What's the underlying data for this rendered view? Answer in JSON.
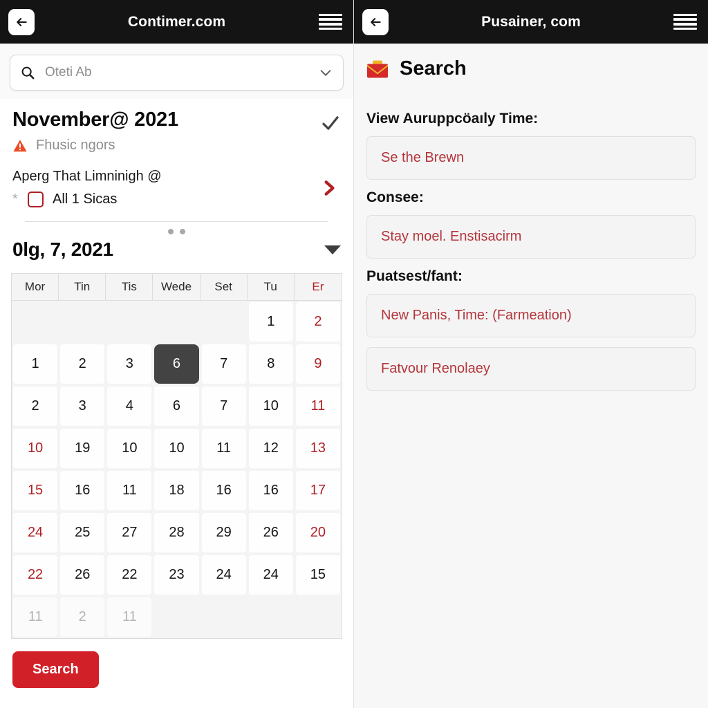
{
  "left": {
    "topbar": {
      "title": "Contimer.com",
      "back_icon": "arrow-left-icon",
      "menu_icon": "hamburger-menu-icon"
    },
    "search": {
      "value": "Oteti Ab",
      "placeholder": "Oteti Ab",
      "search_icon": "search-icon",
      "dropdown_icon": "chevron-down-icon"
    },
    "info": {
      "title": "November@ 2021",
      "check_icon": "checkmark-icon",
      "warning_icon": "warning-triangle-icon",
      "warning_text": "Fhusic ngors",
      "sub_line": "Aperg That Limninigh @",
      "asterisk": "*",
      "checkbox_label": "All 1 Sicas",
      "chevron_icon": "chevron-right-icon"
    },
    "date": {
      "title": "0lg, 7, 2021",
      "caret_icon": "caret-down-icon",
      "dots_count": 2
    },
    "calendar": {
      "weekdays": [
        "Mor",
        "Tin",
        "Tis",
        "Wede",
        "Set",
        "Tu",
        "Er"
      ],
      "weekend_index": 6,
      "weeks": [
        [
          {
            "d": "",
            "style": "empty"
          },
          {
            "d": "",
            "style": "empty"
          },
          {
            "d": "",
            "style": "empty"
          },
          {
            "d": "",
            "style": "empty"
          },
          {
            "d": "",
            "style": "empty"
          },
          {
            "d": "1",
            "style": "normal"
          },
          {
            "d": "2",
            "style": "red"
          }
        ],
        [
          {
            "d": "1",
            "style": "normal"
          },
          {
            "d": "2",
            "style": "normal"
          },
          {
            "d": "3",
            "style": "normal"
          },
          {
            "d": "6",
            "style": "sel"
          },
          {
            "d": "7",
            "style": "normal"
          },
          {
            "d": "8",
            "style": "normal"
          },
          {
            "d": "9",
            "style": "red"
          }
        ],
        [
          {
            "d": "2",
            "style": "normal"
          },
          {
            "d": "3",
            "style": "normal"
          },
          {
            "d": "4",
            "style": "normal"
          },
          {
            "d": "6",
            "style": "normal"
          },
          {
            "d": "7",
            "style": "normal"
          },
          {
            "d": "10",
            "style": "normal"
          },
          {
            "d": "11",
            "style": "red"
          }
        ],
        [
          {
            "d": "10",
            "style": "red"
          },
          {
            "d": "19",
            "style": "normal"
          },
          {
            "d": "10",
            "style": "normal"
          },
          {
            "d": "10",
            "style": "normal"
          },
          {
            "d": "11",
            "style": "normal"
          },
          {
            "d": "12",
            "style": "normal"
          },
          {
            "d": "13",
            "style": "red"
          }
        ],
        [
          {
            "d": "15",
            "style": "red"
          },
          {
            "d": "16",
            "style": "normal"
          },
          {
            "d": "11",
            "style": "normal"
          },
          {
            "d": "18",
            "style": "normal"
          },
          {
            "d": "16",
            "style": "normal"
          },
          {
            "d": "16",
            "style": "normal"
          },
          {
            "d": "17",
            "style": "red"
          }
        ],
        [
          {
            "d": "24",
            "style": "red"
          },
          {
            "d": "25",
            "style": "normal"
          },
          {
            "d": "27",
            "style": "normal"
          },
          {
            "d": "28",
            "style": "normal"
          },
          {
            "d": "29",
            "style": "normal"
          },
          {
            "d": "26",
            "style": "normal"
          },
          {
            "d": "20",
            "style": "red"
          }
        ],
        [
          {
            "d": "22",
            "style": "red"
          },
          {
            "d": "26",
            "style": "normal"
          },
          {
            "d": "22",
            "style": "normal"
          },
          {
            "d": "23",
            "style": "normal"
          },
          {
            "d": "24",
            "style": "normal"
          },
          {
            "d": "24",
            "style": "normal"
          },
          {
            "d": "15",
            "style": "normal"
          }
        ],
        [
          {
            "d": "11",
            "style": "muted"
          },
          {
            "d": "2",
            "style": "muted"
          },
          {
            "d": "11",
            "style": "muted"
          },
          {
            "d": "",
            "style": "empty"
          },
          {
            "d": "",
            "style": "empty"
          },
          {
            "d": "",
            "style": "empty"
          },
          {
            "d": "",
            "style": "empty"
          }
        ]
      ]
    },
    "search_button": "Search"
  },
  "right": {
    "topbar": {
      "title": "Pusainer, com",
      "back_icon": "arrow-left-icon",
      "menu_icon": "hamburger-menu-icon"
    },
    "header": {
      "icon": "envelope-icon",
      "title": "Search"
    },
    "fields": [
      {
        "label": "View Auruppcöaıly Time:",
        "value": "Se the Brewn"
      },
      {
        "label": "Consee:",
        "value": "Stay moel. Enstisacirm"
      },
      {
        "label": "Puatsest/fant:",
        "value": "New Panis, Time: (Farmeation)"
      },
      {
        "label": "",
        "value": "Fatvour Renolaey"
      }
    ]
  },
  "colors": {
    "topbar_bg": "#141414",
    "accent_red": "#b01f24",
    "button_red": "#d22029",
    "warning_orange": "#ee4b23",
    "selected_cell": "#434343",
    "field_value_red": "#b4353c"
  }
}
